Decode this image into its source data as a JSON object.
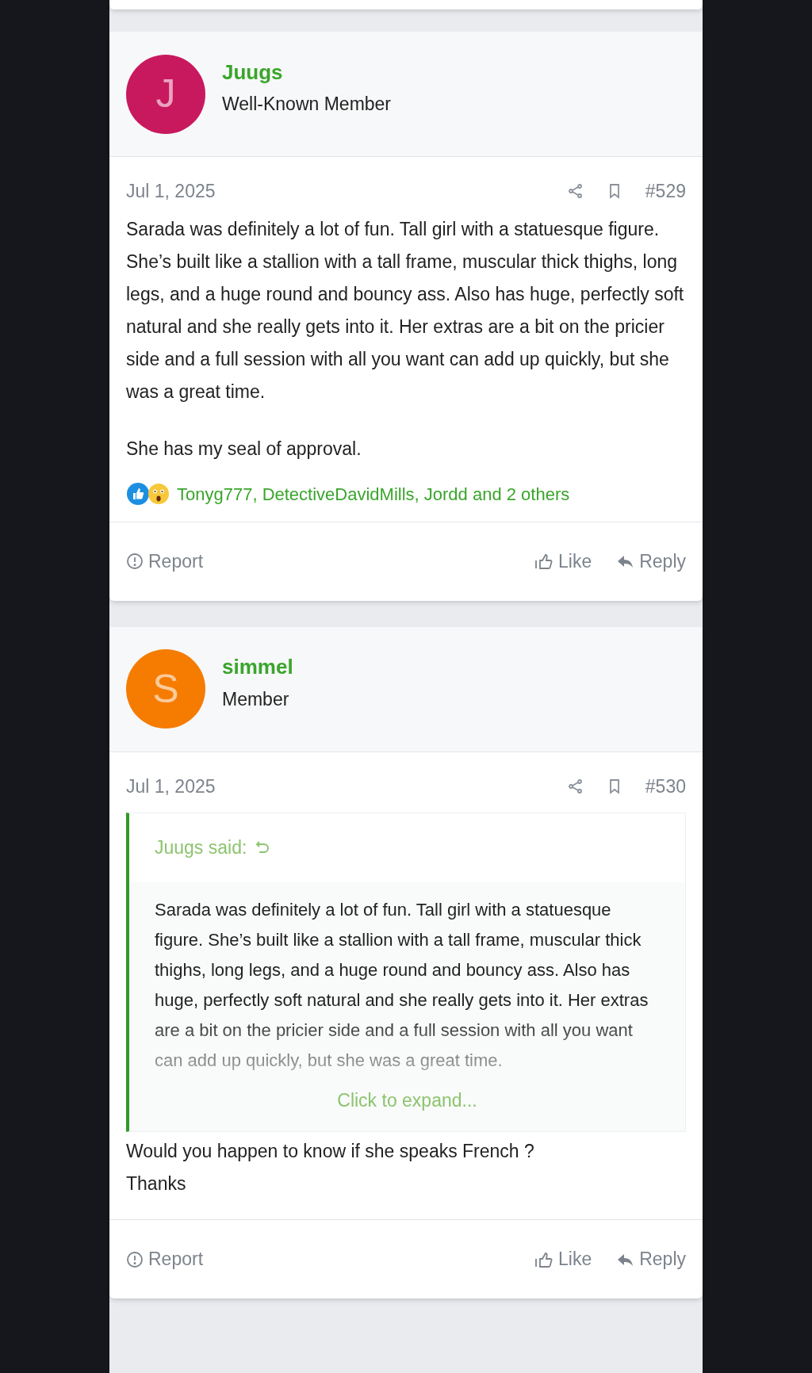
{
  "posts": [
    {
      "author": {
        "initial": "J",
        "color": "#c8195f",
        "name": "Juugs",
        "role": "Well-Known Member"
      },
      "date": "Jul 1, 2025",
      "number": "#529",
      "body": [
        "Sarada was definitely a lot of fun. Tall girl with a statuesque figure. She’s built like a stallion with a tall frame, muscular thick thighs, long legs, and a huge round and bouncy ass. Also has huge, perfectly soft natural and she really gets into it. Her extras are a bit on the pricier side and a full session with all you want can add up quickly, but she was a great time.",
        "She has my seal of approval."
      ],
      "reactions": "Tonyg777, DetectiveDavidMills, Jordd and 2 others",
      "actions": [
        "Report",
        "Like",
        "Reply"
      ]
    },
    {
      "author": {
        "initial": "S",
        "color": "#f57c00",
        "name": "simmel",
        "role": "Member"
      },
      "date": "Jul 1, 2025",
      "number": "#530",
      "quote": {
        "attribution": "Juugs said:",
        "text": "Sarada was definitely a lot of fun. Tall girl with a statuesque figure. She’s built like a stallion with a tall frame, muscular thick thighs, long legs, and a huge round and bouncy ass. Also has huge, perfectly soft natural and she really gets into it. Her extras are a bit on the pricier side and a full session with all you want can add up quickly, but she was a great time.",
        "expand": "Click to expand..."
      },
      "body": [
        "Would you happen to know if she speaks French ?\nThanks"
      ],
      "actions": [
        "Report",
        "Like",
        "Reply"
      ]
    }
  ]
}
